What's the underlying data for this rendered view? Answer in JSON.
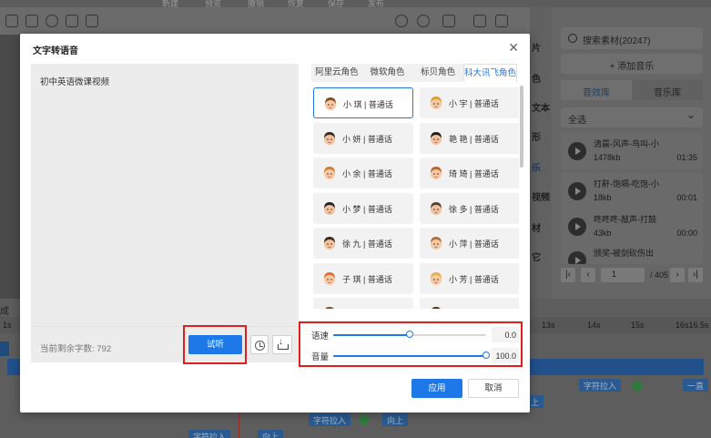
{
  "background": {
    "topbar_labels": [
      "新建",
      "预览",
      "撤销",
      "恢复",
      "保存",
      "发布"
    ],
    "right_strip_labels": [
      "片",
      "色",
      "文本",
      "形",
      "乐",
      "视频",
      "材",
      "它"
    ],
    "search_placeholder": "搜索素材(20247)",
    "add_music": "+ 添加音乐",
    "tabs": [
      "音效库",
      "音乐库"
    ],
    "select_value": "全选",
    "sounds": [
      {
        "name": "清晨-风声-鸟叫-小",
        "size": "1478kb",
        "duration": "01:35"
      },
      {
        "name": "打鼾-饱嗝-吃饱-小",
        "size": "18kb",
        "duration": "00:01"
      },
      {
        "name": "咚咚咚-敲声-打鼓",
        "size": "43kb",
        "duration": "00:00"
      },
      {
        "name": "颁奖-被剑砍伤出",
        "size": "",
        "duration": ""
      }
    ],
    "pager": {
      "page": "1",
      "total": "/ 405"
    },
    "ruler_labels": [
      "1s",
      "13s",
      "14s",
      "15s",
      "16s16.5s"
    ],
    "timeline_left_label": "成",
    "timeline_chips": [
      "字符拉入",
      "上",
      "字符拉入",
      "向上",
      "字符拉入",
      "向上",
      "一直"
    ]
  },
  "modal": {
    "title": "文字转语音",
    "text_content": "初中英语微课视频",
    "remaining_chars": "当前剩余字数: 792",
    "listen_label": "试听",
    "tabs": [
      {
        "label": "阿里云角色",
        "active": false
      },
      {
        "label": "微软角色",
        "active": false
      },
      {
        "label": "标贝角色",
        "active": false
      },
      {
        "label": "科大讯飞角色",
        "active": true
      }
    ],
    "roles": [
      {
        "label": "小 琪 | 普通话",
        "avatar": "girl-avatar-icon",
        "selected": true
      },
      {
        "label": "小 宇 | 普通话",
        "avatar": "boy-avatar-icon",
        "selected": false
      },
      {
        "label": "小 妍 | 普通话",
        "avatar": "man-glasses-avatar-icon",
        "selected": false
      },
      {
        "label": "艳 艳 | 普通话",
        "avatar": "woman-dark-hair-avatar-icon",
        "selected": false
      },
      {
        "label": "小 余 | 普通话",
        "avatar": "boy-avatar-icon",
        "selected": false
      },
      {
        "label": "琦 琦 | 普通话",
        "avatar": "girl-avatar-icon",
        "selected": false
      },
      {
        "label": "小 梦 | 普通话",
        "avatar": "girl-dark-hair-avatar-icon",
        "selected": false
      },
      {
        "label": "徐 多 | 普通话",
        "avatar": "man-avatar-icon",
        "selected": false
      },
      {
        "label": "徐 九 | 普通话",
        "avatar": "man-avatar-icon",
        "selected": false
      },
      {
        "label": "小 萍 | 普通话",
        "avatar": "girl-avatar-icon",
        "selected": false
      },
      {
        "label": "子 琪 | 普通话",
        "avatar": "boy-avatar-icon",
        "selected": false
      },
      {
        "label": "小 芳 | 普通话",
        "avatar": "girl-avatar-icon",
        "selected": false
      },
      {
        "label": "…… | 普通话",
        "avatar": "boy-avatar-icon",
        "selected": false
      },
      {
        "label": "…… | 普通话",
        "avatar": "girl-avatar-icon",
        "selected": false
      }
    ],
    "speed": {
      "label": "语速",
      "value": "0.0",
      "fraction": 0.5
    },
    "volume": {
      "label": "音量",
      "value": "100.0",
      "fraction": 1.0
    },
    "apply_label": "应用",
    "cancel_label": "取消"
  },
  "colors": {
    "primary": "#1e78e8",
    "highlight": "#e01e1e"
  }
}
